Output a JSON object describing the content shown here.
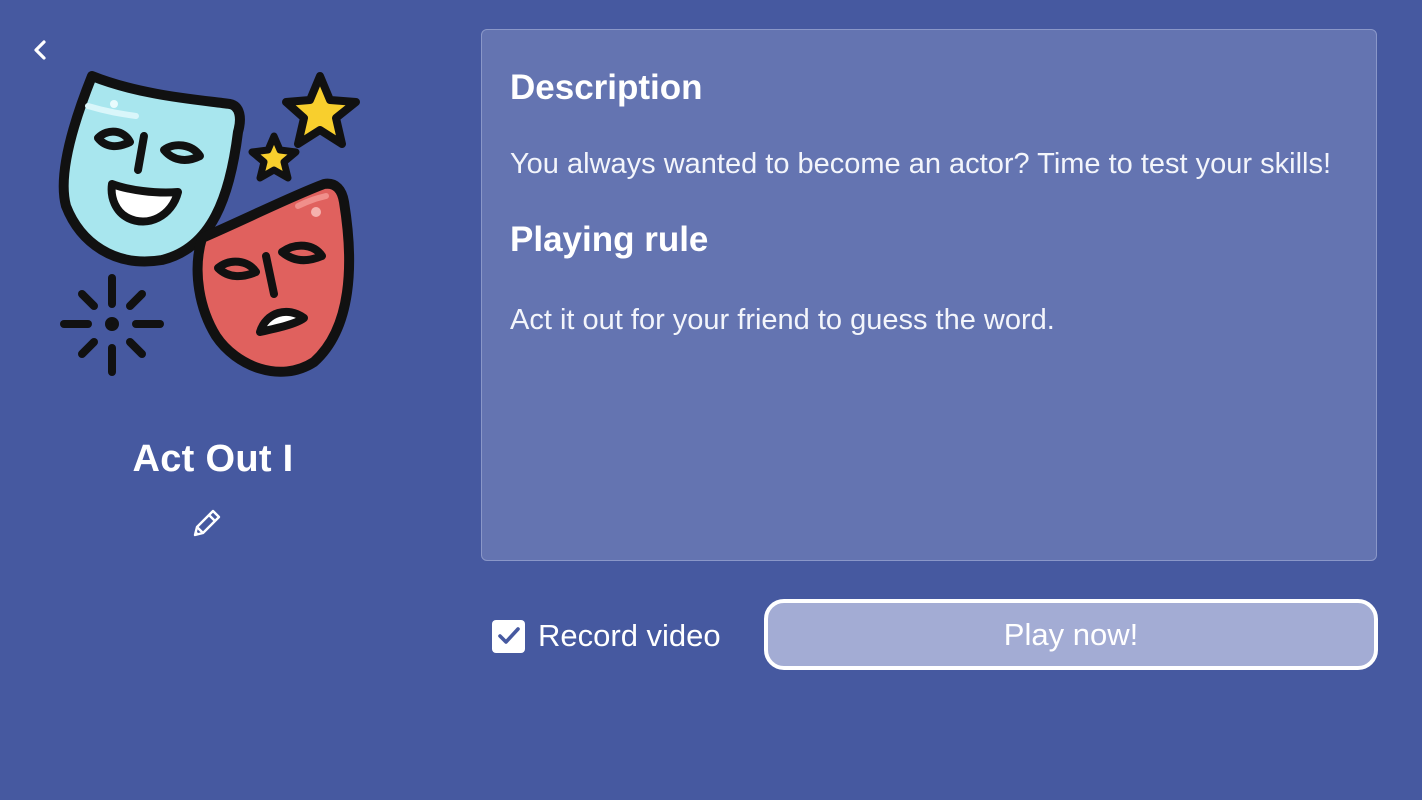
{
  "header": {
    "back_icon": "chevron-left-icon"
  },
  "game": {
    "title": "Act Out I",
    "illustration": "theater-masks-icon",
    "edit_icon": "pencil-icon"
  },
  "panel": {
    "description_heading": "Description",
    "description_text": "You always wanted to become an actor? Time to test your skills!",
    "rule_heading": "Playing rule",
    "rule_text": "Act it out for your friend to guess the word."
  },
  "controls": {
    "record_label": "Record video",
    "record_checked": true,
    "play_label": "Play now!"
  },
  "colors": {
    "background": "#4659a0",
    "panel": "#6474b1",
    "play_button": "#a3acd4",
    "happy_mask": "#a8e6ee",
    "sad_mask": "#e0615e",
    "star": "#f8cf2d"
  }
}
